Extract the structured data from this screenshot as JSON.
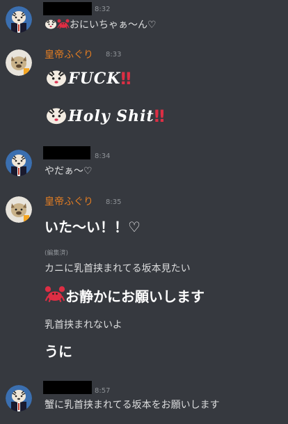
{
  "messages": [
    {
      "time": "8:32",
      "lines": [
        "おにいちゃぁ～ん♡"
      ],
      "avatar": "tiger-avatar"
    },
    {
      "username": "皇帝ふぐり",
      "time": "8:33",
      "lines": [
        "FUCK",
        "‼",
        "Holy Shit",
        "‼"
      ],
      "avatar": "hyena-avatar"
    },
    {
      "time": "8:34",
      "lines": [
        "やだぁ～♡"
      ],
      "avatar": "tiger-avatar"
    },
    {
      "username": "皇帝ふぐり",
      "time": "8:35",
      "lines": [
        "いた～い！！♡",
        "(編集済)",
        "カニに乳首挟まれてる坂本見たい",
        "お静かにお願いします",
        "乳首挟まれないよ",
        "うに"
      ],
      "avatar": "hyena-avatar"
    },
    {
      "time": "8:57",
      "lines": [
        "蟹に乳首挟まれてる坂本をお願いします"
      ],
      "avatar": "tiger-avatar"
    }
  ],
  "colors": {
    "background": "#36393f",
    "username": "#e67e22",
    "text": "#dcddde",
    "timestamp": "#8e9297",
    "redaction": "#000000"
  },
  "icons": [
    "tiger-emoji",
    "crab-emoji",
    "double-exclamation-icon"
  ]
}
